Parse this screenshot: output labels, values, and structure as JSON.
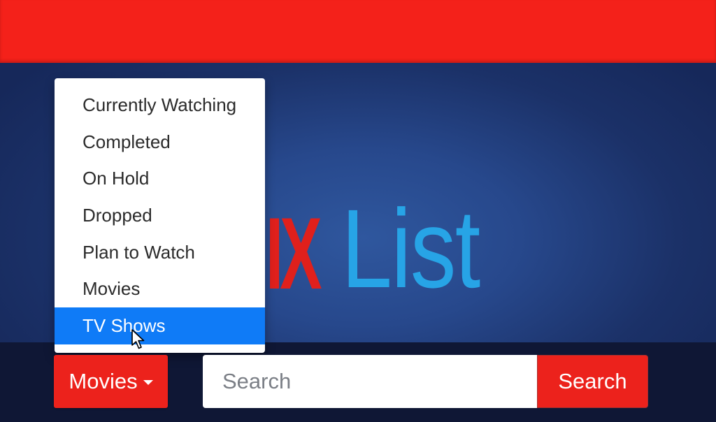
{
  "header": {
    "color": "#f4211a"
  },
  "logo": {
    "red_part": "IX",
    "blue_part": "List",
    "colors": {
      "red": "#e0201c",
      "blue": "#27a4e6"
    }
  },
  "dropdown": {
    "items": [
      {
        "label": "Currently Watching",
        "active": false
      },
      {
        "label": "Completed",
        "active": false
      },
      {
        "label": "On Hold",
        "active": false
      },
      {
        "label": "Dropped",
        "active": false
      },
      {
        "label": "Plan to Watch",
        "active": false
      },
      {
        "label": "Movies",
        "active": false
      },
      {
        "label": "TV Shows",
        "active": true
      }
    ],
    "highlight_color": "#0f7bf7"
  },
  "toolbar": {
    "category_button_label": "Movies",
    "category_button_icon": "caret-down-icon",
    "search_placeholder": "Search",
    "search_value": "",
    "search_button_label": "Search",
    "button_color": "#ec221c"
  },
  "cursor": {
    "icon": "mouse-pointer-icon",
    "hovering": "TV Shows"
  }
}
